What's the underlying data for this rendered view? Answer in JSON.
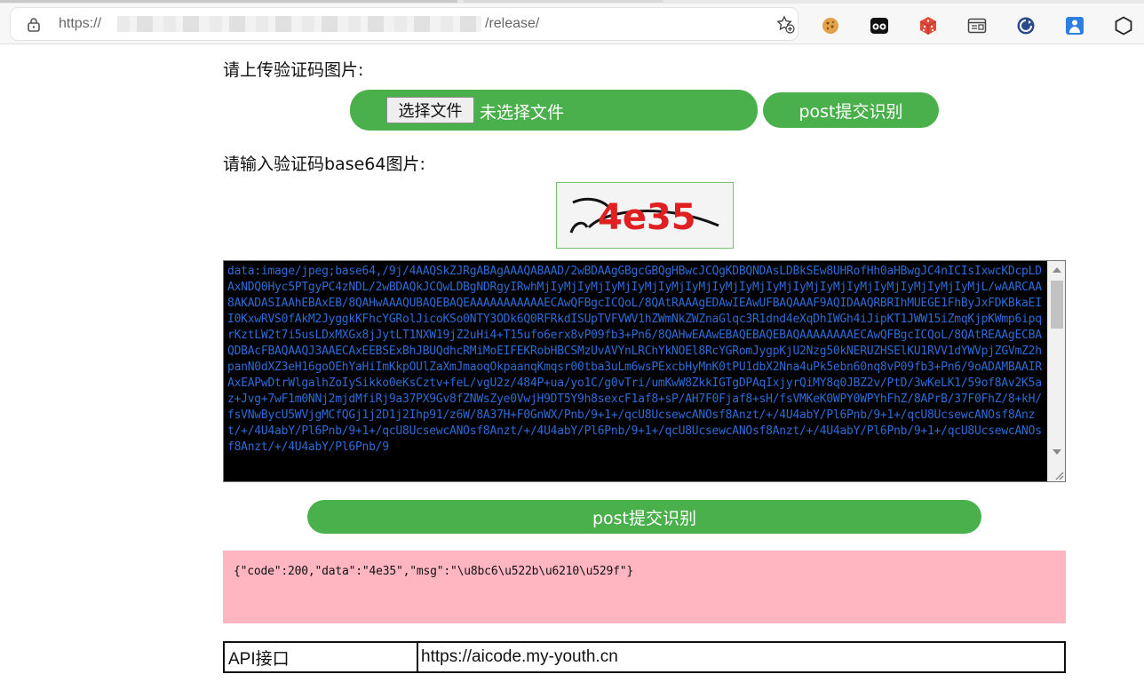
{
  "browser": {
    "url_prefix": "https://",
    "url_suffix": "/release/",
    "extensions": [
      "cookie-icon",
      "sunglasses-icon",
      "dice-icon",
      "reader-icon",
      "refresh-circle-icon",
      "person-icon",
      "hexagon-icon"
    ]
  },
  "upload": {
    "label": "请上传验证码图片:",
    "choose_button": "选择文件",
    "no_file_text": "未选择文件",
    "submit_button": "post提交识别"
  },
  "base64": {
    "label": "请输入验证码base64图片:",
    "captcha_text": "4e35",
    "textarea_value": "data:image/jpeg;base64,/9j/4AAQSkZJRgABAgAAAQABAAD/2wBDAAgGBgcGBQgHBwcJCQgKDBQNDAsLDBkSEw8UHRofHh0aHBwgJC4nICIsIxwcKDcpLDAxNDQ0Hyc5PTgyPC4zNDL/2wBDAQkJCQwLDBgNDRgyIRwhMjIyMjIyMjIyMjIyMjIyMjIyMjIyMjIyMjIyMjIyMjIyMjIyMjIyMjIyMjIyMjIyMjL/wAARCAA8AKADASIAAhEBAxEB/8QAHwAAAQUBAQEBAQEAAAAAAAAAAAECAwQFBgcICQoL/8QAtRAAAgEDAwIEAwUFBAQAAAF9AQIDAAQRBRIhMUEGE1FhByJxFDKBkaEII0KxwRVS0fAkM2JyggkKFhcYGRolJicoKSo0NTY3ODk6Q0RFRkdISUpTVFVWV1hZWmNkZWZnaGlqc3R1dnd4eXqDhIWGh4iJipKT1JWW15iZmqKjpKWmp6ipqrKztLW2t7i5usLDxMXGx8jJytLT1NXW19jZ2uHi4+T15ufo6erx8vP09fb3+Pn6/8QAHwEAAwEBAQEBAQEBAQAAAAAAAAECAwQFBgcICQoL/8QAtREAAgECBAQDBAcFBAQAAQJ3AAECAxEEBSExBhJBUQdhcRMiMoEIFEKRobHBCSMzUvAVYnLRChYkNOEl8RcYGRomJygpKjU2Nzg50kNERUZHSElKU1RVV1dYWVpjZGVmZ2hpanN0dXZ3eH16goOEhYaHiImKkpOUlZaXmJmaoqOkpaanqKmqsr00tba3uLm6wsPExcbHyMnK0tPU1dbX2Nna4uPk5ebn60nq8vP09fb3+Pn6/9oADAMBAAIRAxEAPwDtrWlgalhZoIySikko0eKsCztv+feL/vgU2z/484P+ua/yo1C/g0vTri/umKwW8ZkkIGTgDPAqIxjyrQiMY8q0JBZ2v/PtD/3wKeLK1/59of8Av2K5az+Jvg+7wF1m0NNj2mjdMfiRj9a37PX9Gv8fZNWsZye0VwjH9DT5Y9h8sexcF1af8+sP/AH7F0Fjaf8+sH/fsVMKeK0WPY0WPYhFhZ/8APrB/37F0FhZ/8+kH/fsVNwBycU5WVjgMCfQGj1j2D1j2Ihp91/z6W/8A37H+F0GnWX/Pnb/9+1+/qcU8UcsewcANOsf8Anzt/+/4U4abY/Pl6Pnb/9+1+/qcU8UcsewcANOsf8Anzt/+/4U4abY/Pl6Pnb/9+1+/qcU8UcsewcANOsf8Anzt/+/4U4abY/Pl6Pnb/9+1+/qcU8UcsewcANOsf8Anzt/+/4U4abY/Pl6Pnb/9+1+/qcU8UcsewcANOsf8Anzt/+/4U4abY/Pl6Pnb/9"
  },
  "submit2": {
    "label": "post提交识别"
  },
  "result": {
    "text": "{\"code\":200,\"data\":\"4e35\",\"msg\":\"\\u8bc6\\u522b\\u6210\\u529f\"}"
  },
  "api": {
    "key": "API接口",
    "value": "https://aicode.my-youth.cn"
  },
  "colors": {
    "accent_green": "#49b04c",
    "result_bg": "#ffb6c1",
    "textarea_bg": "#000000",
    "textarea_text": "#2d6cd8"
  }
}
